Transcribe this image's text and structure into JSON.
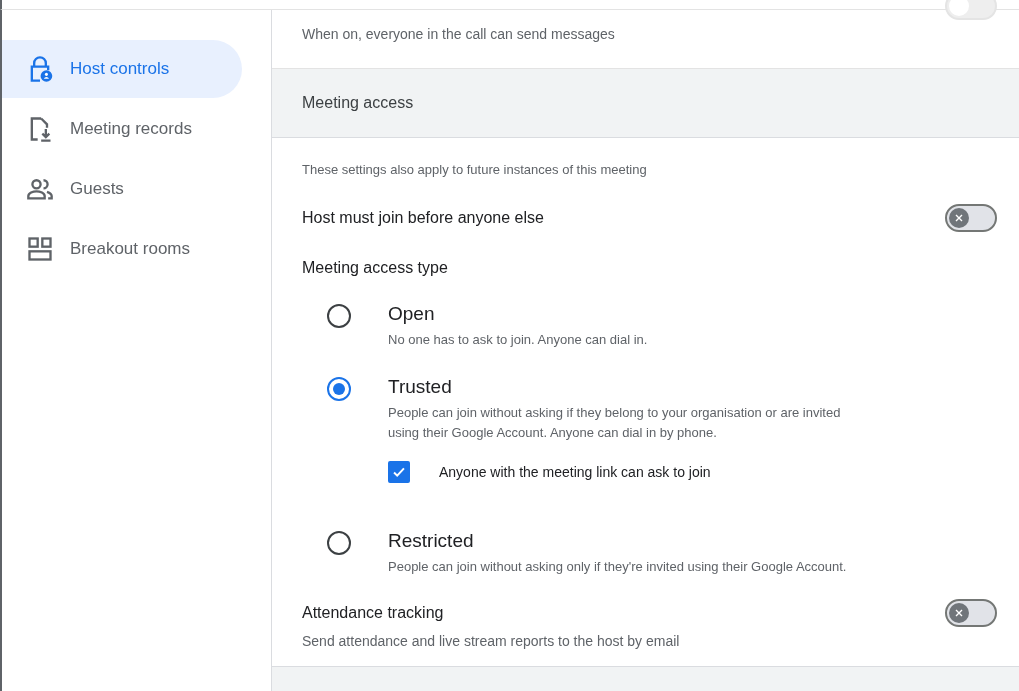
{
  "sidebar": {
    "items": [
      {
        "label": "Host controls",
        "selected": true
      },
      {
        "label": "Meeting records",
        "selected": false
      },
      {
        "label": "Guests",
        "selected": false
      },
      {
        "label": "Breakout rooms",
        "selected": false
      }
    ]
  },
  "top_setting": {
    "description": "When on, everyone in the call can send messages",
    "on": false
  },
  "meeting_access": {
    "title": "Meeting access",
    "note": "These settings also apply to future instances of this meeting",
    "host_must_join": {
      "label": "Host must join before anyone else",
      "on": false
    },
    "access_type": {
      "label": "Meeting access type",
      "options": [
        {
          "label": "Open",
          "description": "No one has to ask to join. Anyone can dial in.",
          "selected": false
        },
        {
          "label": "Trusted",
          "description": "People can join without asking if they belong to your organisation or are invited using their Google Account. Anyone can dial in by phone.",
          "selected": true,
          "checkbox": {
            "label": "Anyone with the meeting link can ask to join",
            "checked": true
          }
        },
        {
          "label": "Restricted",
          "description": "People can join without asking only if they're invited using their Google Account.",
          "selected": false
        }
      ]
    },
    "attendance": {
      "label": "Attendance tracking",
      "description": "Send attendance and live stream reports to the host by email",
      "on": false
    }
  }
}
